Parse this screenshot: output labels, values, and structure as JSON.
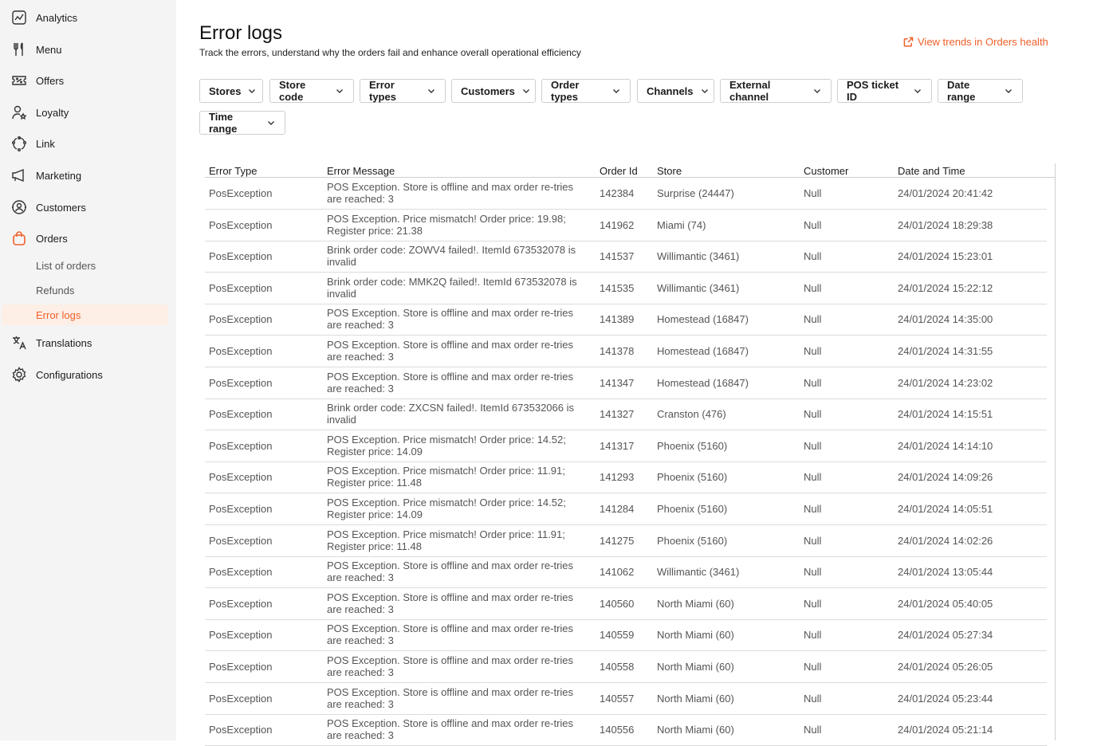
{
  "sidebar": {
    "items": [
      {
        "label": "Analytics",
        "icon": "analytics-icon"
      },
      {
        "label": "Menu",
        "icon": "fork-knife-icon"
      },
      {
        "label": "Offers",
        "icon": "ticket-icon"
      },
      {
        "label": "Loyalty",
        "icon": "user-star-icon"
      },
      {
        "label": "Link",
        "icon": "link-cycle-icon"
      },
      {
        "label": "Marketing",
        "icon": "megaphone-icon"
      },
      {
        "label": "Customers",
        "icon": "customers-icon"
      },
      {
        "label": "Orders",
        "icon": "shopping-bag-icon"
      },
      {
        "label": "Translations",
        "icon": "translate-icon"
      },
      {
        "label": "Configurations",
        "icon": "gear-icon"
      }
    ],
    "orders_sub": [
      {
        "label": "List of orders"
      },
      {
        "label": "Refunds"
      },
      {
        "label": "Error logs"
      }
    ]
  },
  "header": {
    "title": "Error logs",
    "subtitle": "Track the errors, understand why the orders fail and enhance overall operational efficiency",
    "trend_link": "View trends in Orders health"
  },
  "filters": [
    "Stores",
    "Store code",
    "Error types",
    "Customers",
    "Order types",
    "Channels",
    "External channel",
    "POS ticket ID",
    "Date range",
    "Time range"
  ],
  "table": {
    "columns": [
      "Error Type",
      "Error Message",
      "Order Id",
      "Store",
      "Customer",
      "Date and Time"
    ],
    "rows": [
      {
        "type": "PosException",
        "msg1": "POS Exception. Store is offline and max order re-tries",
        "msg2": "are reached: 3",
        "order": "142384",
        "store": "Surprise (24447)",
        "customer": "Null",
        "datetime": "24/01/2024 20:41:42"
      },
      {
        "type": "PosException",
        "msg1": "POS Exception. Price mismatch! Order price: 19.98;",
        "msg2": "Register price: 21.38",
        "order": "141962",
        "store": "Miami (74)",
        "customer": "Null",
        "datetime": "24/01/2024 18:29:38"
      },
      {
        "type": "PosException",
        "msg1": "Brink order code: ZOWV4 failed!. ItemId 673532078 is",
        "msg2": "invalid",
        "order": "141537",
        "store": "Willimantic (3461)",
        "customer": "Null",
        "datetime": "24/01/2024 15:23:01"
      },
      {
        "type": "PosException",
        "msg1": "Brink order code: MMK2Q failed!. ItemId 673532078 is",
        "msg2": "invalid",
        "order": "141535",
        "store": "Willimantic (3461)",
        "customer": "Null",
        "datetime": "24/01/2024 15:22:12"
      },
      {
        "type": "PosException",
        "msg1": "POS Exception. Store is offline and max order re-tries",
        "msg2": "are reached: 3",
        "order": "141389",
        "store": "Homestead (16847)",
        "customer": "Null",
        "datetime": "24/01/2024 14:35:00"
      },
      {
        "type": "PosException",
        "msg1": "POS Exception. Store is offline and max order re-tries",
        "msg2": "are reached: 3",
        "order": "141378",
        "store": "Homestead (16847)",
        "customer": "Null",
        "datetime": "24/01/2024 14:31:55"
      },
      {
        "type": "PosException",
        "msg1": "POS Exception. Store is offline and max order re-tries",
        "msg2": "are reached: 3",
        "order": "141347",
        "store": "Homestead (16847)",
        "customer": "Null",
        "datetime": "24/01/2024 14:23:02"
      },
      {
        "type": "PosException",
        "msg1": "Brink order code: ZXCSN failed!. ItemId 673532066 is",
        "msg2": "invalid",
        "order": "141327",
        "store": "Cranston (476)",
        "customer": "Null",
        "datetime": "24/01/2024 14:15:51"
      },
      {
        "type": "PosException",
        "msg1": "POS Exception. Price mismatch! Order price: 14.52;",
        "msg2": "Register price: 14.09",
        "order": "141317",
        "store": "Phoenix (5160)",
        "customer": "Null",
        "datetime": "24/01/2024 14:14:10"
      },
      {
        "type": "PosException",
        "msg1": "POS Exception. Price mismatch! Order price: 11.91;",
        "msg2": "Register price: 11.48",
        "order": "141293",
        "store": "Phoenix (5160)",
        "customer": "Null",
        "datetime": "24/01/2024 14:09:26"
      },
      {
        "type": "PosException",
        "msg1": "POS Exception. Price mismatch! Order price: 14.52;",
        "msg2": "Register price: 14.09",
        "order": "141284",
        "store": "Phoenix (5160)",
        "customer": "Null",
        "datetime": "24/01/2024 14:05:51"
      },
      {
        "type": "PosException",
        "msg1": "POS Exception. Price mismatch! Order price: 11.91;",
        "msg2": "Register price: 11.48",
        "order": "141275",
        "store": "Phoenix (5160)",
        "customer": "Null",
        "datetime": "24/01/2024 14:02:26"
      },
      {
        "type": "PosException",
        "msg1": "POS Exception. Store is offline and max order re-tries",
        "msg2": "are reached: 3",
        "order": "141062",
        "store": "Willimantic (3461)",
        "customer": "Null",
        "datetime": "24/01/2024 13:05:44"
      },
      {
        "type": "PosException",
        "msg1": "POS Exception. Store is offline and max order re-tries",
        "msg2": "are reached: 3",
        "order": "140560",
        "store": "North Miami (60)",
        "customer": "Null",
        "datetime": "24/01/2024 05:40:05"
      },
      {
        "type": "PosException",
        "msg1": "POS Exception. Store is offline and max order re-tries",
        "msg2": "are reached: 3",
        "order": "140559",
        "store": "North Miami (60)",
        "customer": "Null",
        "datetime": "24/01/2024 05:27:34"
      },
      {
        "type": "PosException",
        "msg1": "POS Exception. Store is offline and max order re-tries",
        "msg2": "are reached: 3",
        "order": "140558",
        "store": "North Miami (60)",
        "customer": "Null",
        "datetime": "24/01/2024 05:26:05"
      },
      {
        "type": "PosException",
        "msg1": "POS Exception. Store is offline and max order re-tries",
        "msg2": "are reached: 3",
        "order": "140557",
        "store": "North Miami (60)",
        "customer": "Null",
        "datetime": "24/01/2024 05:23:44"
      },
      {
        "type": "PosException",
        "msg1": "POS Exception. Store is offline and max order re-tries",
        "msg2": "are reached: 3",
        "order": "140556",
        "store": "North Miami (60)",
        "customer": "Null",
        "datetime": "24/01/2024 05:21:14"
      }
    ]
  },
  "colors": {
    "accent": "#f0602a",
    "sidebar_bg": "#f4f4f4",
    "active_bg": "#fdeee6"
  }
}
